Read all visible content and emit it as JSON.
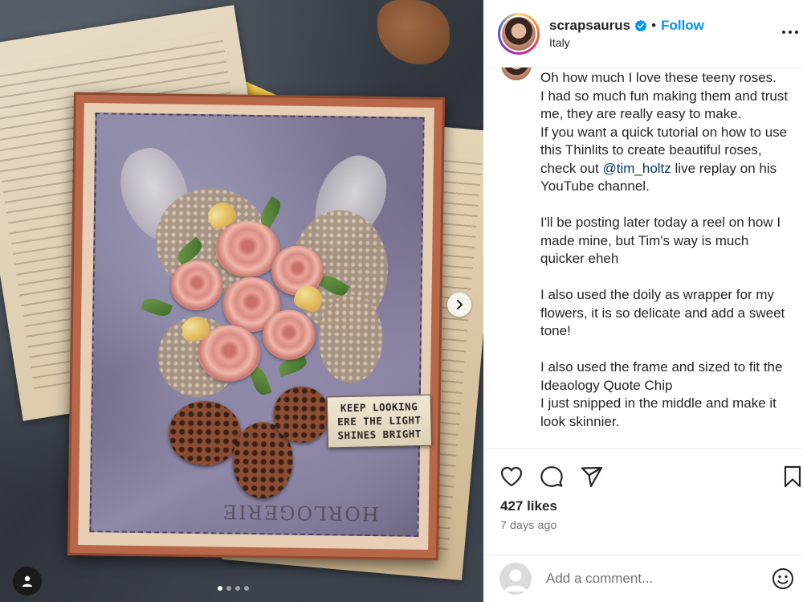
{
  "post": {
    "username": "scrapsaurus",
    "follow_label": "Follow",
    "separator": "•",
    "location": "Italy",
    "caption": {
      "part1": "Oh how much I love these teeny roses.\nI had so much fun making them and trust me, they are really easy to make.\nIf you want a quick tutorial on how to use this Thinlits to create beautiful roses, check out ",
      "mention": "@tim_holtz",
      "part2": " live replay on his YouTube channel.\n\nI'll be posting later today a reel on how I made mine, but Tim's way is much quicker eheh\n\nI also used the doily as wrapper for my flowers, it is so delicate and add a sweet tone!\n\nI also used the frame and sized to fit the Ideaology Quote Chip\nI just snipped in the middle and make it look skinnier."
    },
    "likes": "427 likes",
    "time_ago": "7 days ago",
    "comment_placeholder": "Add a comment..."
  },
  "media": {
    "quote_chip": [
      "KEEP LOOKING",
      "ERE THE LIGHT",
      "SHINES BRIGHT"
    ],
    "stamp_text": "HORLOGERIE",
    "carousel": {
      "count": 4,
      "active": 0
    }
  },
  "icons": {
    "verified": "verified-badge-icon",
    "more": "more-options-icon",
    "like": "heart-icon",
    "comment": "comment-bubble-icon",
    "share": "paper-plane-icon",
    "save": "bookmark-icon",
    "emoji": "smiley-icon",
    "next": "chevron-right-icon",
    "tag": "user-tag-icon"
  },
  "colors": {
    "link_blue": "#0095f6",
    "verified_blue": "#0095f6",
    "mention": "#00376b",
    "muted_text": "#737373"
  }
}
